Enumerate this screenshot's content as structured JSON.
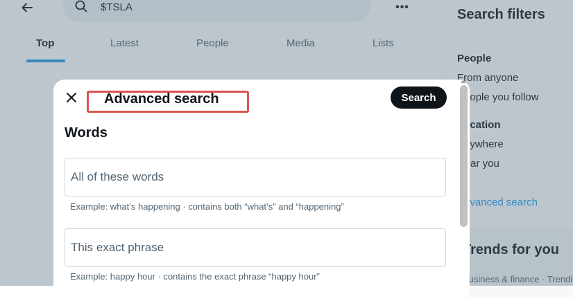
{
  "header": {
    "search_query": "$TSLA",
    "more_label": "•••"
  },
  "tabs": [
    {
      "label": "Top",
      "active": true
    },
    {
      "label": "Latest",
      "active": false
    },
    {
      "label": "People",
      "active": false
    },
    {
      "label": "Media",
      "active": false
    },
    {
      "label": "Lists",
      "active": false
    }
  ],
  "sidebar": {
    "title": "Search filters",
    "people_label": "People",
    "people_options": [
      "From anyone",
      "People you follow"
    ],
    "location_label": "Location",
    "location_options": [
      "Anywhere",
      "Near you"
    ],
    "advanced_link": "Advanced search",
    "trends_title": "Trends for you",
    "trends_meta": "Business & finance · Trending"
  },
  "modal": {
    "title": "Advanced search",
    "search_button": "Search",
    "section_words": "Words",
    "fields": [
      {
        "placeholder": "All of these words",
        "value": "",
        "helper": "Example: what’s happening · contains both “what’s” and “happening”"
      },
      {
        "placeholder": "This exact phrase",
        "value": "",
        "helper": "Example: happy hour · contains the exact phrase “happy hour”"
      }
    ]
  },
  "colors": {
    "accent": "#1d9bf0",
    "primary_text": "#0f1419",
    "secondary_text": "#536471",
    "highlight_box": "#d9534f",
    "overlay": "rgba(91,112,131,0.40)"
  },
  "icons": {
    "back": "arrow-left-icon",
    "search": "search-icon",
    "close": "close-icon",
    "more": "more-horizontal-icon"
  }
}
